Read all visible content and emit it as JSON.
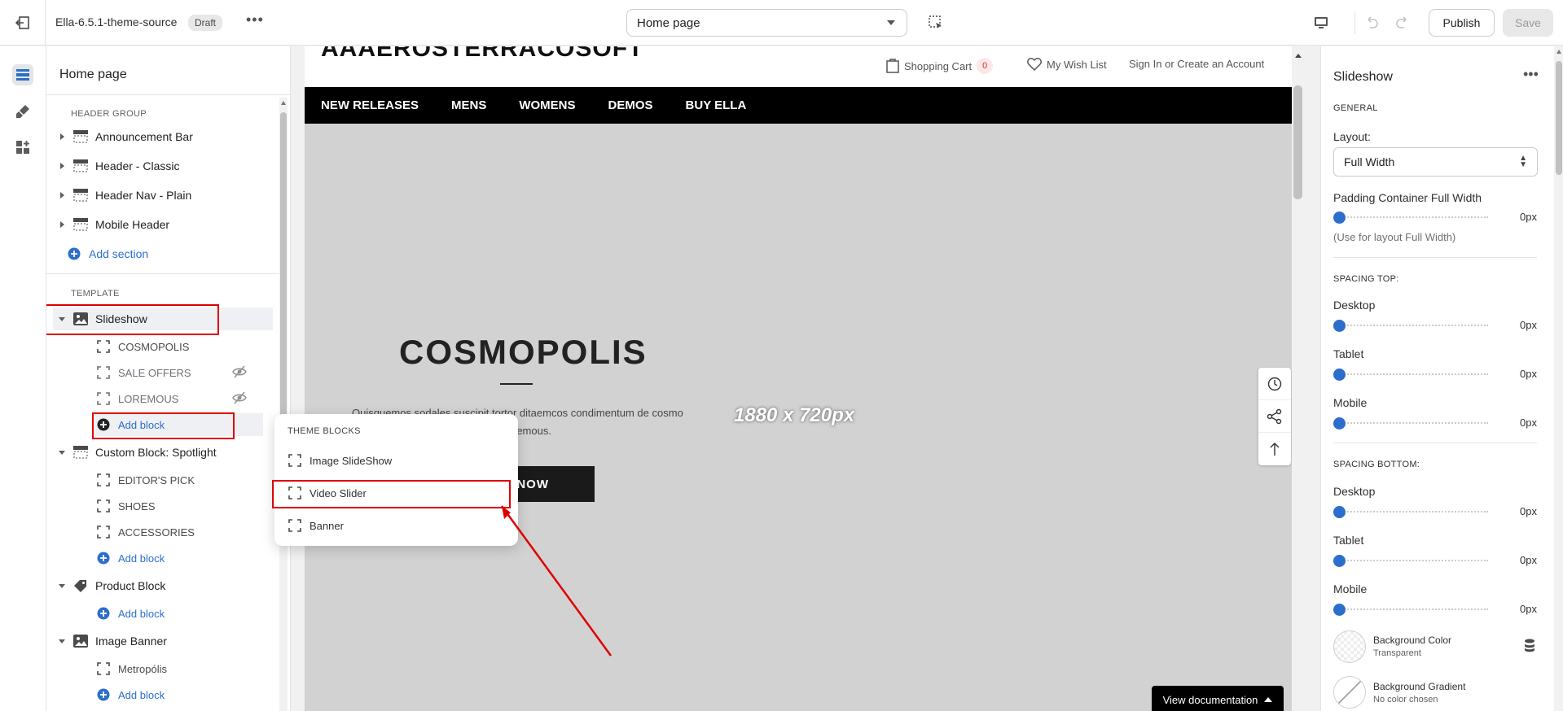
{
  "topbar": {
    "theme_name": "Ella-6.5.1-theme-source",
    "status_badge": "Draft",
    "more": "•••",
    "page_select": "Home page",
    "publish_label": "Publish",
    "save_label": "Save"
  },
  "left": {
    "title": "Home page",
    "header_group_label": "HEADER GROUP",
    "header_items": [
      "Announcement Bar",
      "Header - Classic",
      "Header Nav - Plain",
      "Mobile Header"
    ],
    "add_section": "Add section",
    "template_label": "TEMPLATE",
    "slideshow": {
      "label": "Slideshow",
      "blocks": [
        "COSMOPOLIS",
        "SALE OFFERS",
        "LOREMOUS"
      ],
      "add_block": "Add block"
    },
    "spotlight": {
      "label": "Custom Block: Spotlight",
      "blocks": [
        "EDITOR'S PICK",
        "SHOES",
        "ACCESSORIES"
      ],
      "add_block": "Add block"
    },
    "product_block": {
      "label": "Product Block",
      "add_block": "Add block"
    },
    "image_banner": {
      "label": "Image Banner",
      "blocks": [
        "Metropólis"
      ],
      "add_block": "Add block"
    }
  },
  "popup": {
    "heading": "THEME BLOCKS",
    "items": [
      "Image SlideShow",
      "Video Slider",
      "Banner"
    ]
  },
  "preview": {
    "logo": "AAAEROSTERRACOSOFT",
    "shopping_cart": "Shopping Cart",
    "cart_count": "0",
    "wish_list": "My Wish List",
    "sign_in": "Sign In or Create an Account",
    "nav": [
      "NEW RELEASES",
      "MENS",
      "WOMENS",
      "DEMOS",
      "BUY ELLA"
    ],
    "hero_title": "COSMOPOLIS",
    "hero_desc": "Quisquemos sodales suscipit tortor ditaemcos condimentum de cosmo lacus meleifend menean diverra loremous.",
    "hero_button": "NOW",
    "image_dims": "1880 x 720px",
    "view_documentation": "View documentation"
  },
  "right": {
    "title": "Slideshow",
    "more": "•••",
    "general": "GENERAL",
    "layout_label": "Layout:",
    "layout_value": "Full Width",
    "padding_label": "Padding Container Full Width",
    "padding_value": "0px",
    "padding_hint": "(Use for layout Full Width)",
    "spacing_top": "SPACING TOP:",
    "spacing_bottom": "SPACING BOTTOM:",
    "desktop": "Desktop",
    "tablet": "Tablet",
    "mobile": "Mobile",
    "zero": "0px",
    "bg_color_label": "Background Color",
    "bg_color_value": "Transparent",
    "bg_gradient_label": "Background Gradient",
    "bg_gradient_value": "No color chosen"
  },
  "colors": {
    "accent": "#2c6ecb",
    "highlight": "#e00000"
  }
}
